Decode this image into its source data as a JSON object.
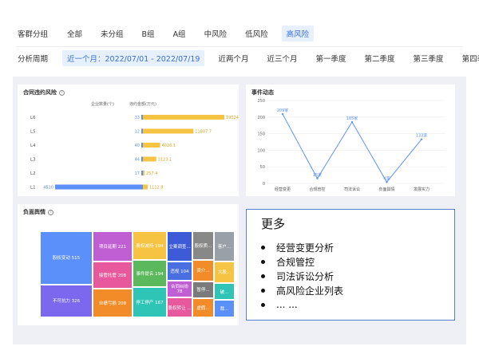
{
  "filters": {
    "group_label": "客群分组",
    "groups": [
      {
        "label": "全部",
        "active": false
      },
      {
        "label": "未分组",
        "active": false
      },
      {
        "label": "B组",
        "active": false
      },
      {
        "label": "A组",
        "active": false
      },
      {
        "label": "中风险",
        "active": false
      },
      {
        "label": "低风险",
        "active": false
      },
      {
        "label": "高风险",
        "active": true
      }
    ],
    "period_label": "分析周期",
    "periods": [
      {
        "label": "近一个月：2022/07/01 - 2022/07/19",
        "active": true
      },
      {
        "label": "近两个月",
        "active": false
      },
      {
        "label": "近三个月",
        "active": false
      },
      {
        "label": "第一季度",
        "active": false
      },
      {
        "label": "第二季度",
        "active": false
      },
      {
        "label": "第三季度",
        "active": false
      },
      {
        "label": "第四季度",
        "active": false
      }
    ]
  },
  "contract_risk": {
    "title": "合同违约风险",
    "col_count": "企业数量(个)",
    "col_amount": "违约金额(万元)",
    "colors": {
      "count": "#5b8ff9",
      "amount": "#f6c343"
    }
  },
  "events": {
    "title": "事件动态",
    "line_color": "#5b8ff9"
  },
  "negative": {
    "title": "负面舆情"
  },
  "more": {
    "title": "更多",
    "items": [
      "经营变更分析",
      "合规管控",
      "司法诉讼分析",
      "高风险企业列表",
      "... ..."
    ]
  },
  "chart_data": [
    {
      "type": "bar",
      "title": "合同违约风险",
      "categories": [
        "L6",
        "L5",
        "L4",
        "L3",
        "L2",
        "L1"
      ],
      "series": [
        {
          "name": "企业数量(个)",
          "values": [
            33,
            12,
            40,
            44,
            17,
            4510
          ],
          "labels": [
            "33",
            "12",
            "40",
            "44",
            "17",
            "4510"
          ]
        },
        {
          "name": "违约金额(万元)",
          "values": [
            19024.7,
            11807.7,
            4026.1,
            3123.1,
            257.4,
            1112.8
          ],
          "labels": [
            "19024.7",
            "11807.7",
            "4026.1",
            "3123.1",
            "257.4",
            "1112.8"
          ]
        }
      ]
    },
    {
      "type": "line",
      "title": "事件动态",
      "categories": [
        "经营变更",
        "合规管控",
        "司法诉讼",
        "负面舆情",
        "发展实力"
      ],
      "values": [
        209,
        15,
        185,
        4,
        133
      ],
      "labels": [
        "209家",
        "15家",
        "185家",
        "4家",
        "133家"
      ],
      "ylim": [
        0,
        250
      ],
      "yticks": [
        "0",
        "50",
        "100",
        "150",
        "200",
        "250"
      ],
      "grid": true
    },
    {
      "type": "treemap",
      "title": "负面舆情",
      "cells": [
        {
          "label": "股权变动 515",
          "value": 515,
          "color": "#5b8ff9"
        },
        {
          "label": "不可抗力 326",
          "value": 326,
          "color": "#7b68ee"
        },
        {
          "label": "项目延期 221",
          "value": 221,
          "color": "#c05fd4"
        },
        {
          "label": "接管托管 208",
          "value": 208,
          "color": "#e8589c"
        },
        {
          "label": "业绩亏损 208",
          "value": 208,
          "color": "#f28c28"
        },
        {
          "label": "股权减持 194",
          "value": 194,
          "color": "#f6c343"
        },
        {
          "label": "事件提名 194",
          "value": 194,
          "color": "#5cb85c"
        },
        {
          "label": "停工停产 167",
          "value": 167,
          "color": "#2ec4b6"
        },
        {
          "label": "立案调查...",
          "value": 130,
          "color": "#3d5bd6"
        },
        {
          "label": "股权质...",
          "value": 110,
          "color": "#888888"
        },
        {
          "label": "客户...",
          "value": 90,
          "color": "#9aa0a8"
        },
        {
          "label": "违规 104",
          "value": 104,
          "color": "#4a6fe3"
        },
        {
          "label": "资介...",
          "value": 80,
          "color": "#f28c28"
        },
        {
          "label": "大股...",
          "value": 75,
          "color": "#f6c343"
        },
        {
          "label": "合同纠纷 78",
          "value": 78,
          "color": "#c05fd4"
        },
        {
          "label": "暂停...",
          "value": 60,
          "color": "#7a7a7a"
        },
        {
          "label": "破...",
          "value": 50,
          "color": "#2ec4b6"
        },
        {
          "label": "股权转让 ...",
          "value": 70,
          "color": "#e8589c"
        },
        {
          "label": "虚假...",
          "value": 50,
          "color": "#f28c28"
        },
        {
          "label": "裁...",
          "value": 40,
          "color": "#5b8ff9"
        }
      ]
    }
  ]
}
